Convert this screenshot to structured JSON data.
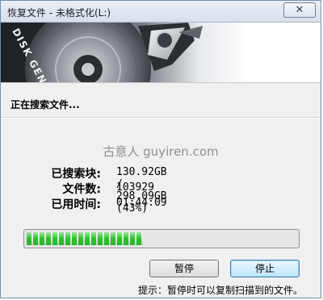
{
  "window": {
    "title": "恢复文件 - 未格式化(L:)",
    "close_label": "✕"
  },
  "banner": {
    "logo_text": "DISK GENIUS"
  },
  "status": {
    "searching_text": "正在搜索文件..."
  },
  "watermark": "古意人 guyiren.com",
  "stats": {
    "searched_label": "已搜索块:",
    "searched_value": "130.92GB / 298.09GB (43%)",
    "files_label": "文件数:",
    "files_value": "103929",
    "elapsed_label": "已用时间:",
    "elapsed_value": "01:44:09"
  },
  "progress": {
    "fraction": 0.43,
    "color": "#2fc52f"
  },
  "buttons": {
    "pause_label": "暂停",
    "stop_label": "停止"
  },
  "hint": "提示：暂停时可以复制扫描到的文件。"
}
